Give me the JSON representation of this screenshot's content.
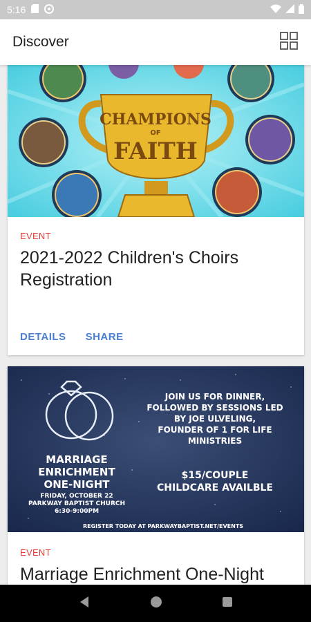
{
  "status_bar": {
    "time": "5:16",
    "icons": [
      "sd-card-icon",
      "sync-icon",
      "wifi-icon",
      "signal-icon",
      "battery-icon"
    ]
  },
  "app_bar": {
    "title": "Discover",
    "view_toggle_icon": "grid-view-icon"
  },
  "cards": [
    {
      "image": {
        "wordmark_top": "CHAMPIONS",
        "wordmark_of": "OF",
        "wordmark_bottom": "FAITH",
        "colors": {
          "sky": "#55d3e3",
          "trophy": "#e9b82c",
          "trophy_dark": "#b98319"
        }
      },
      "kind": "EVENT",
      "title": "2021-2022 Children's Choirs Registration",
      "actions": {
        "details": "DETAILS",
        "share": "SHARE"
      }
    },
    {
      "image": {
        "event_title_line1": "MARRIAGE",
        "event_title_line2": "ENRICHMENT",
        "event_title_line3": "ONE-NIGHT",
        "date_line": "FRIDAY, OCTOBER 22",
        "venue_line": "PARKWAY BAPTIST CHURCH",
        "time_line": "6:30-9:00PM",
        "info_lines": [
          "JOIN US FOR DINNER,",
          "FOLLOWED BY SESSIONS LED",
          "BY JOE ULVELING,",
          "FOUNDER OF 1 FOR LIFE",
          "MINISTRIES"
        ],
        "price_line": "$15/COUPLE",
        "childcare_line": "CHILDCARE AVAILBLE",
        "register_line": "REGISTER TODAY AT PARKWAYBAPTIST.NET/EVENTS",
        "colors": {
          "background": "#1f3157"
        }
      },
      "kind": "EVENT",
      "title": "Marriage Enrichment One-Night"
    }
  ],
  "nav_bar": {
    "icons": [
      "back-icon",
      "home-icon",
      "recents-icon"
    ]
  },
  "colors": {
    "event_label": "#e53935",
    "action_link": "#4a7fd1"
  }
}
